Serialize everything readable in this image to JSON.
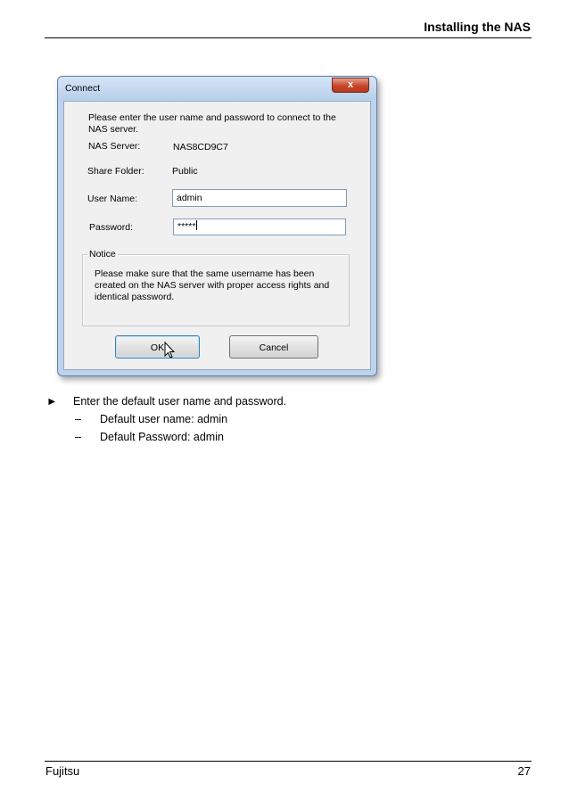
{
  "header": {
    "title": "Installing the NAS"
  },
  "dialog": {
    "title": "Connect",
    "close_glyph": "x",
    "prompt": "Please enter the user name and password to connect to the NAS server.",
    "nas_server_label": "NAS Server:",
    "nas_server_value": "NAS8CD9C7",
    "share_folder_label": "Share Folder:",
    "share_folder_value": "Public",
    "user_name_label": "User Name:",
    "user_name_value": "admin",
    "password_label": "Password:",
    "password_value": "*****",
    "notice_label": "Notice",
    "notice_text": "Please make sure that the same username has been created on the NAS server with proper access rights and identical password.",
    "ok_label": "OK",
    "cancel_label": "Cancel"
  },
  "body": {
    "bullet_glyph": "►",
    "instruction": "Enter the default user name and password.",
    "dash_glyph": "–",
    "items": [
      "Default user name: admin",
      "Default Password: admin"
    ]
  },
  "footer": {
    "left": "Fujitsu",
    "page_number": "27"
  }
}
